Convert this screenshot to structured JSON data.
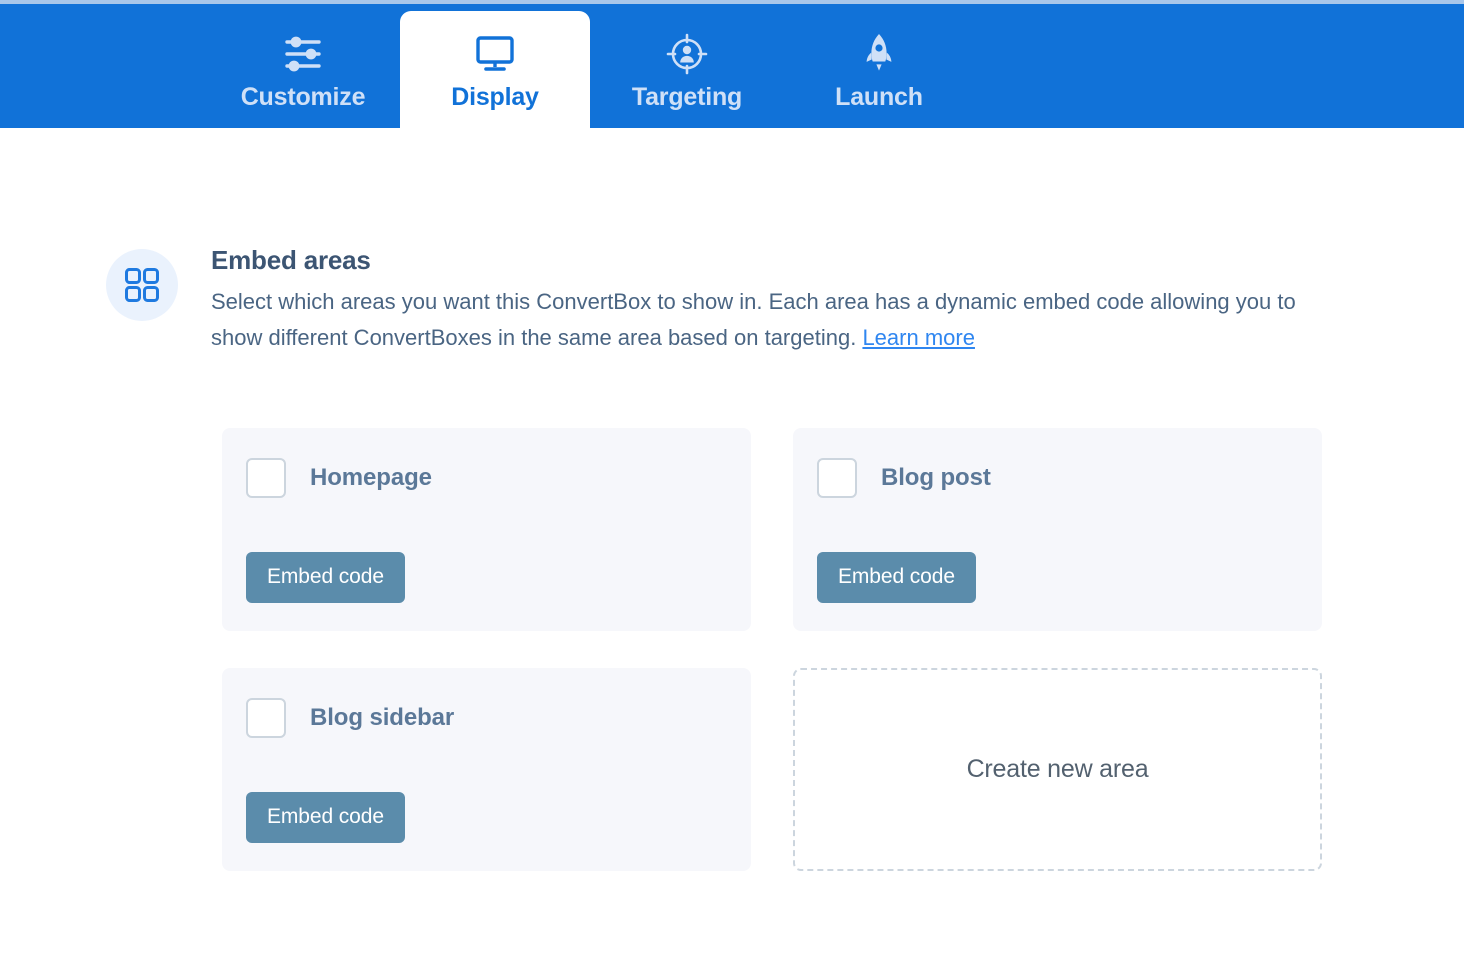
{
  "tabs": [
    {
      "label": "Customize",
      "icon": "sliders-icon",
      "active": false
    },
    {
      "label": "Display",
      "icon": "monitor-icon",
      "active": true
    },
    {
      "label": "Targeting",
      "icon": "target-person-icon",
      "active": false
    },
    {
      "label": "Launch",
      "icon": "rocket-icon",
      "active": false
    }
  ],
  "section": {
    "icon": "grid-icon",
    "title": "Embed areas",
    "description": "Select which areas you want this ConvertBox to show in. Each area has a dynamic embed code allowing you to show different ConvertBoxes in the same area based on targeting. ",
    "learn_more": "Learn more"
  },
  "areas": [
    {
      "label": "Homepage",
      "checked": false,
      "button": "Embed code"
    },
    {
      "label": "Blog post",
      "checked": false,
      "button": "Embed code"
    },
    {
      "label": "Blog sidebar",
      "checked": false,
      "button": "Embed code"
    }
  ],
  "create_area": {
    "label": "Create new area"
  },
  "colors": {
    "brand_blue": "#1172d8",
    "tab_inactive_text": "#cfe0f7",
    "heading": "#3c5573",
    "body_text": "#4a6583",
    "link": "#2f86f0",
    "card_bg": "#f6f7fb",
    "button_bg": "#5b8cab",
    "checkbox_border": "#ccd5de",
    "icon_circle_bg": "#eaf2fd"
  }
}
